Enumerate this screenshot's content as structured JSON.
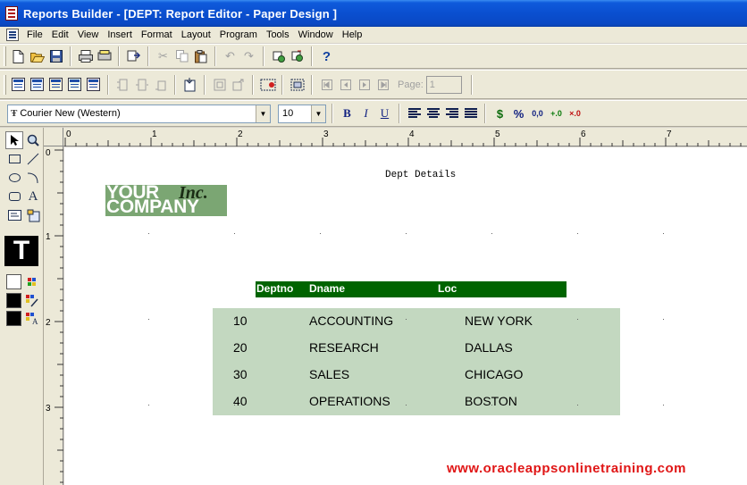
{
  "window": {
    "title": "Reports Builder - [DEPT: Report Editor - Paper Design ]"
  },
  "menu": [
    "File",
    "Edit",
    "View",
    "Insert",
    "Format",
    "Layout",
    "Program",
    "Tools",
    "Window",
    "Help"
  ],
  "toolbar": {
    "page_label": "Page:",
    "page_value": "1"
  },
  "font": {
    "name": "Courier New (Western)",
    "size": "10",
    "bold": "B",
    "italic": "I",
    "underline": "U",
    "currency": "$",
    "percent": "%",
    "comma": "0,0",
    "add_decimal": "+.0",
    "remove_decimal": "×.0"
  },
  "tools": {
    "text_preview": "T"
  },
  "ruler": {
    "h_labels": [
      "0",
      "1",
      "2",
      "3",
      "4",
      "5",
      "6",
      "7"
    ],
    "v_labels": [
      "0",
      "1",
      "2",
      "3"
    ]
  },
  "report": {
    "title": "Dept Details",
    "logo": {
      "line1": "YOUR",
      "inc": "Inc.",
      "line2": "COMPANY"
    },
    "headers": {
      "deptno": "Deptno",
      "dname": "Dname",
      "loc": "Loc"
    },
    "rows": [
      {
        "deptno": "10",
        "dname": "ACCOUNTING",
        "loc": "NEW YORK"
      },
      {
        "deptno": "20",
        "dname": "RESEARCH",
        "loc": "DALLAS"
      },
      {
        "deptno": "30",
        "dname": "SALES",
        "loc": "CHICAGO"
      },
      {
        "deptno": "40",
        "dname": "OPERATIONS",
        "loc": "BOSTON"
      }
    ],
    "watermark": "www.oracleappsonlinetraining.com"
  },
  "colors": {
    "header_bg": "#006400",
    "data_bg": "#c3d8c0",
    "logo_bg": "#7ba673",
    "watermark": "#e01515"
  }
}
